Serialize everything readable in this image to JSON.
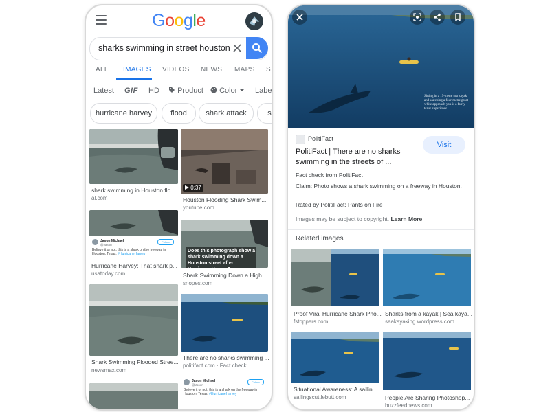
{
  "left": {
    "logo": "Google",
    "search_query": "sharks swimming in street houston",
    "tabs": [
      "ALL",
      "IMAGES",
      "VIDEOS",
      "NEWS",
      "MAPS",
      "S"
    ],
    "active_tab": "IMAGES",
    "filters": [
      "Latest",
      "GIF",
      "HD",
      "Product",
      "Color",
      "Labe"
    ],
    "chips": [
      "hurricane harvey",
      "flood",
      "shark attack",
      "sn"
    ],
    "results": [
      {
        "caption": "shark swimming in Houston flo...",
        "source": "al.com"
      },
      {
        "caption": "Hurricane Harvey: That shark p...",
        "source": "usatoday.com",
        "tweet": {
          "name": "Jason Michael",
          "handle": "@Jason",
          "follow": "Follow",
          "text": "Believe it or not, this is a shark on the freeway in Houston, Texas.",
          "hashtag": "#HurricaneHarvey"
        }
      },
      {
        "caption": "Shark Swimming Flooded Stree...",
        "source": "newsmax.com"
      },
      {
        "caption": "",
        "source": ""
      },
      {
        "caption": "Houston Flooding Shark Swim...",
        "source": "youtube.com",
        "duration": "0:37"
      },
      {
        "caption": "Shark Swimming Down a High...",
        "source": "snopes.com",
        "overlay": "Does this photograph show a shark swimming down a Houston street after Hurricane Harvey?"
      },
      {
        "caption": "There are no sharks swimming ...",
        "source": "politifact.com · Fact check"
      },
      {
        "caption": "",
        "source": "",
        "tweet": {
          "name": "Jason Michael",
          "handle": "@Jason",
          "follow": "Follow",
          "text": "Believe it or not, this is a shark on the freeway in Houston, Texas.",
          "hashtag": "#HurricaneHarvey"
        }
      }
    ]
  },
  "right": {
    "hero_caption": "Sitting in a 15-metre sea kayak and watching a four-metre great white approach you is a fairly tense experience",
    "source_name": "PolitiFact",
    "title": "PolitiFact | There are no sharks swimming in the streets of ...",
    "visit": "Visit",
    "fact_check": "Fact check from PolitiFact",
    "claim": "Claim: Photo shows a shark swimming on a freeway in Houston.",
    "rating": "Rated by PolitiFact: Pants on Fire",
    "copyright": "Images may be subject to copyright.",
    "learn_more": "Learn More",
    "related_title": "Related images",
    "related": [
      {
        "caption": "Proof Viral Hurricane Shark Pho...",
        "source": "fstoppers.com"
      },
      {
        "caption": "Sharks from a kayak | Sea kaya...",
        "source": "seakayaking.wordpress.com"
      },
      {
        "caption": "Situational Awareness: A sailin...",
        "source": "sailingscuttlebutt.com"
      },
      {
        "caption": "People Are Sharing Photoshop...",
        "source": "buzzfeednews.com"
      }
    ]
  },
  "colors": {
    "accent": "#1a73e8",
    "search_button": "#4285f4",
    "ocean": "#1f4f7a"
  },
  "icons": [
    "menu-icon",
    "clear-icon",
    "search-icon",
    "tag-icon",
    "palette-icon",
    "chevron-down-icon",
    "close-icon",
    "lens-icon",
    "share-icon",
    "bookmark-icon",
    "play-icon"
  ]
}
